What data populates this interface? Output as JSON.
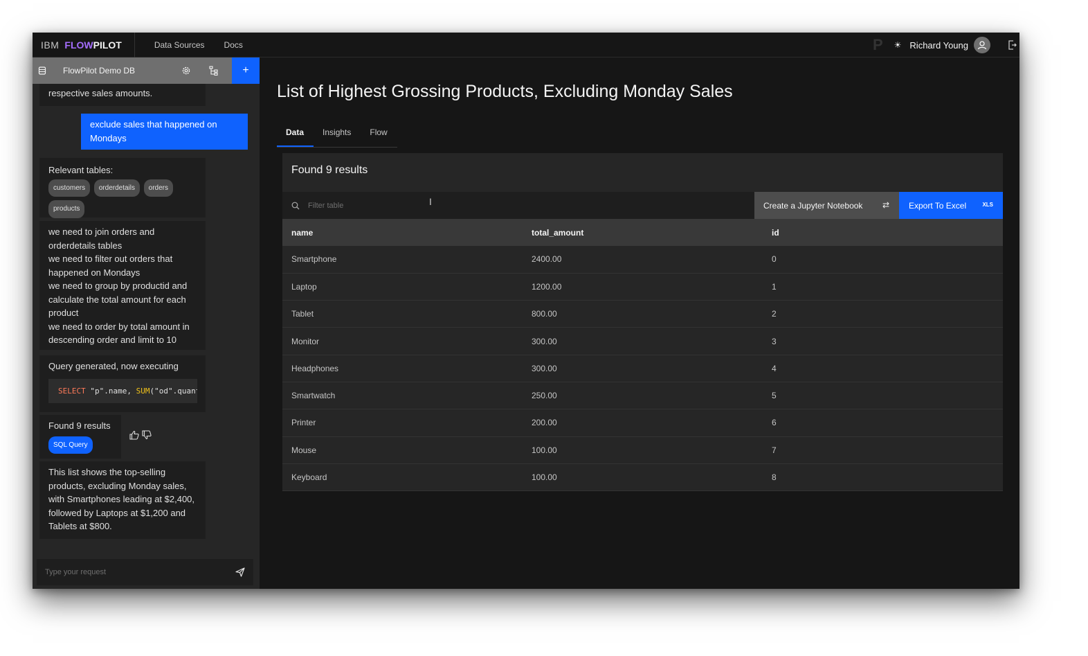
{
  "header": {
    "brand_ibm": "IBM",
    "brand_flow": "FLOW",
    "brand_pilot": "PILOT",
    "nav": [
      "Data Sources",
      "Docs"
    ],
    "user_name": "Richard Young"
  },
  "sidebar": {
    "db_name": "FlowPilot Demo DB",
    "add_label": "+",
    "messages": {
      "prev_tail": "respective sales amounts.",
      "user_request": "exclude sales that happened on Mondays",
      "relevant_label": "Relevant tables:",
      "tables": [
        "customers",
        "orderdetails",
        "orders",
        "products"
      ],
      "steps": [
        "we need to join orders and orderdetails tables",
        "we need to filter out orders that happened on Mondays",
        "we need to group by productid and calculate the total amount for each product",
        "we need to order by total amount in descending order and limit to 10"
      ],
      "query_status": "Query generated, now executing",
      "code_kw": "SELECT",
      "code_part1": " \"p\".name, ",
      "code_fn": "SUM",
      "code_part2": "(\"od\".quantity *",
      "found": "Found 9 results",
      "sql_tag": "SQL Query",
      "summary": "This list shows the top-selling products, excluding Monday sales, with Smartphones leading at $2,400, followed by Laptops at $1,200 and Tablets at $800."
    },
    "input_placeholder": "Type your request"
  },
  "main": {
    "title": "List of Highest Grossing Products, Excluding Monday Sales",
    "tabs": [
      "Data",
      "Insights",
      "Flow"
    ],
    "results_title": "Found 9 results",
    "filter_placeholder": "Filter table",
    "jupyter_label": "Create a Jupyter Notebook",
    "export_label": "Export To Excel",
    "export_badge": "XLS",
    "columns": [
      "name",
      "total_amount",
      "id"
    ],
    "rows": [
      [
        "Smartphone",
        "2400.00",
        "0"
      ],
      [
        "Laptop",
        "1200.00",
        "1"
      ],
      [
        "Tablet",
        "800.00",
        "2"
      ],
      [
        "Monitor",
        "300.00",
        "3"
      ],
      [
        "Headphones",
        "300.00",
        "4"
      ],
      [
        "Smartwatch",
        "250.00",
        "5"
      ],
      [
        "Printer",
        "200.00",
        "6"
      ],
      [
        "Mouse",
        "100.00",
        "7"
      ],
      [
        "Keyboard",
        "100.00",
        "8"
      ]
    ]
  },
  "colors": {
    "accent": "#0f62fe",
    "brand_flow": "#a56eff",
    "background": "#161616",
    "panel": "#262626"
  }
}
